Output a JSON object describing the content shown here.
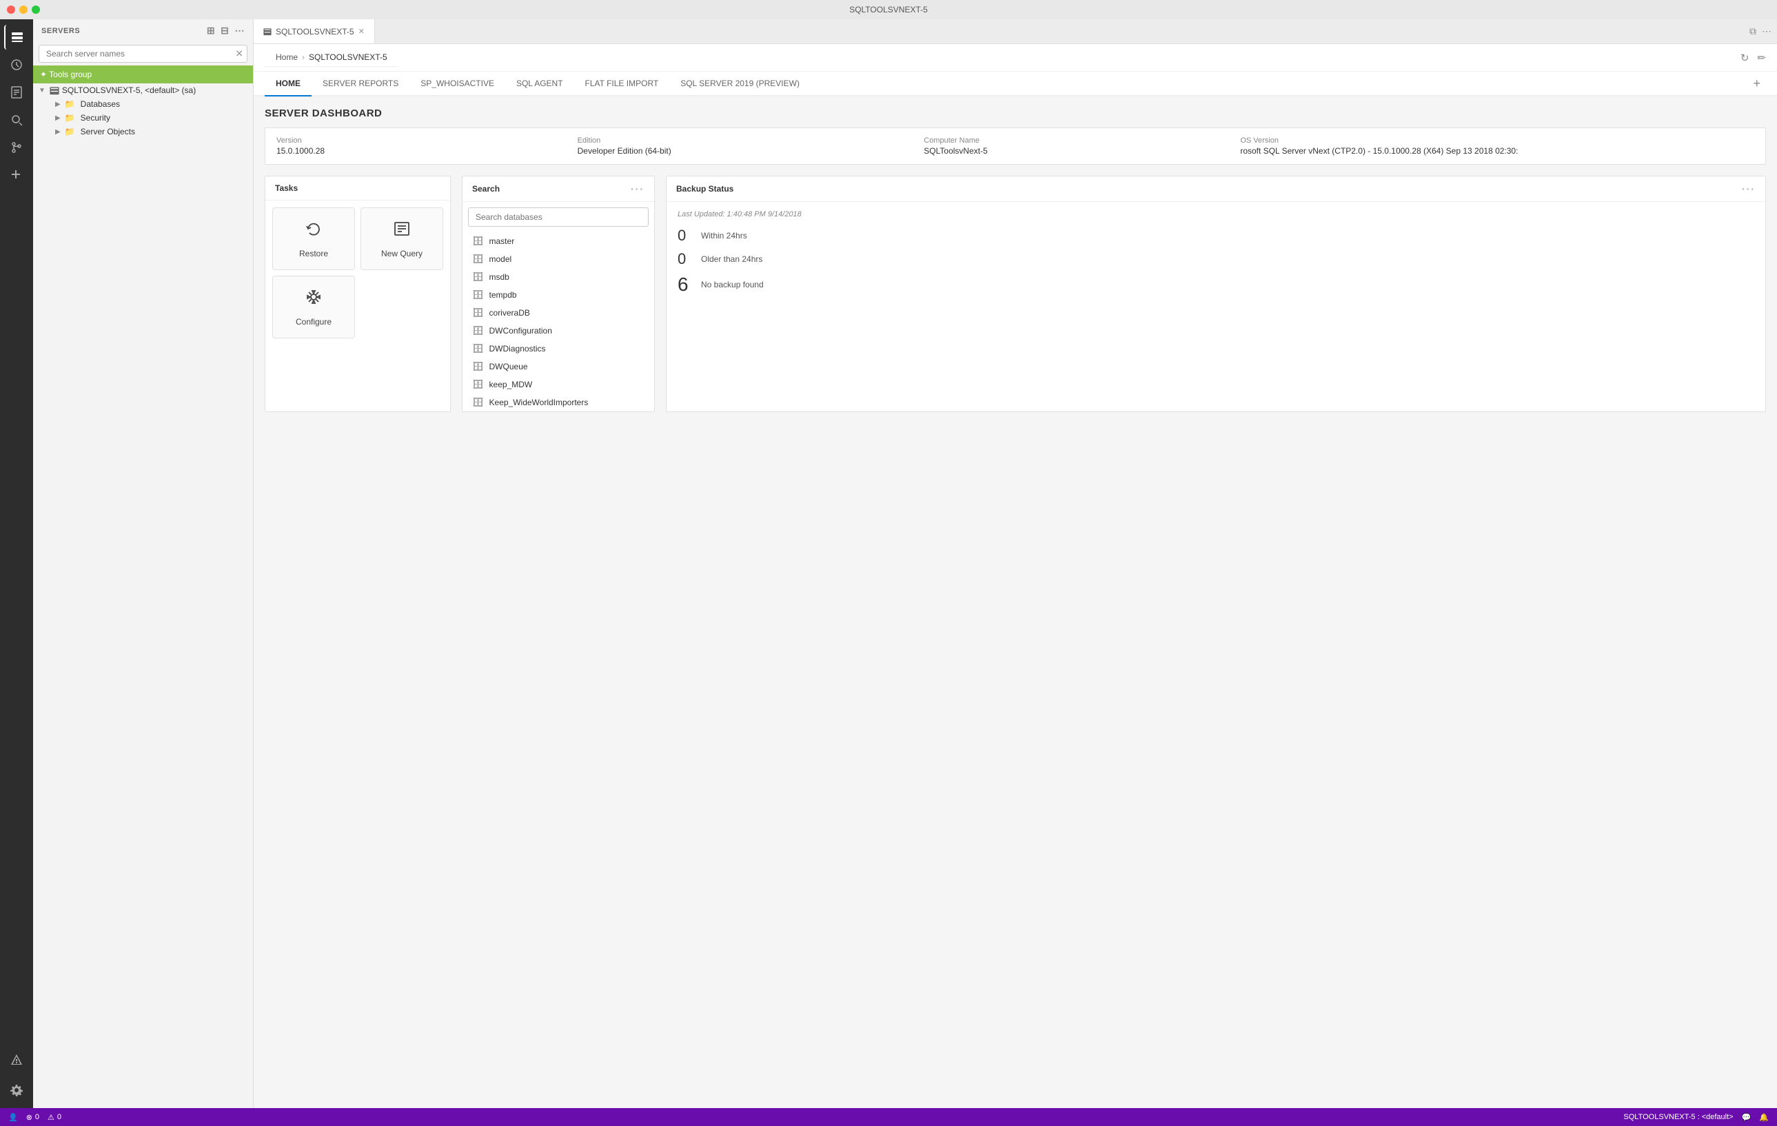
{
  "titleBar": {
    "title": "SQLTOOLSVNEXT-5"
  },
  "activityBar": {
    "icons": [
      {
        "name": "servers-icon",
        "symbol": "⊞",
        "active": true
      },
      {
        "name": "history-icon",
        "symbol": "🕐",
        "active": false
      },
      {
        "name": "documents-icon",
        "symbol": "📄",
        "active": false
      },
      {
        "name": "search-icon",
        "symbol": "🔍",
        "active": false
      },
      {
        "name": "git-icon",
        "symbol": "⑂",
        "active": false
      },
      {
        "name": "extensions-icon",
        "symbol": "⬡",
        "active": false
      },
      {
        "name": "alert-icon",
        "symbol": "⚠",
        "active": false
      }
    ],
    "bottomIcons": [
      {
        "name": "settings-icon",
        "symbol": "⚙"
      }
    ]
  },
  "sidebar": {
    "header": "SERVERS",
    "searchPlaceholder": "Search server names",
    "toolsGroup": "✦ Tools group",
    "serverTree": {
      "serverName": "SQLTOOLSVNEXT-5, <default> (sa)",
      "children": [
        {
          "label": "Databases",
          "icon": "📁"
        },
        {
          "label": "Security",
          "icon": "📁"
        },
        {
          "label": "Server Objects",
          "icon": "📁"
        }
      ]
    }
  },
  "tabs": {
    "openTab": "SQLTOOLSVNEXT-5",
    "closeIcon": "✕"
  },
  "breadcrumb": {
    "home": "Home",
    "sep": "›",
    "current": "SQLTOOLSVNEXT-5"
  },
  "contentTabs": [
    {
      "label": "HOME",
      "active": true
    },
    {
      "label": "SERVER REPORTS",
      "active": false
    },
    {
      "label": "SP_WHOISACTIVE",
      "active": false
    },
    {
      "label": "SQL AGENT",
      "active": false
    },
    {
      "label": "FLAT FILE IMPORT",
      "active": false
    },
    {
      "label": "SQL SERVER 2019 (PREVIEW)",
      "active": false
    }
  ],
  "dashboard": {
    "title": "SERVER DASHBOARD",
    "serverInfo": {
      "versionLabel": "Version",
      "versionValue": "15.0.1000.28",
      "editionLabel": "Edition",
      "editionValue": "Developer Edition (64-bit)",
      "computerNameLabel": "Computer Name",
      "computerNameValue": "SQLToolsvNext-5",
      "osVersionLabel": "OS Version",
      "osVersionValue": "rosoft SQL Server vNext (CTP2.0) - 15.0.1000.28 (X64) Sep 13 2018 02:30:"
    }
  },
  "tasksPanel": {
    "title": "Tasks",
    "buttons": [
      {
        "label": "Restore",
        "icon": "↩"
      },
      {
        "label": "New Query",
        "icon": "☰"
      },
      {
        "label": "Configure",
        "icon": "⚙"
      }
    ]
  },
  "searchPanel": {
    "title": "Search",
    "placeholder": "Search databases",
    "databases": [
      "master",
      "model",
      "msdb",
      "tempdb",
      "coriveraDB",
      "DWConfiguration",
      "DWDiagnostics",
      "DWQueue",
      "keep_MDW",
      "Keep_WideWorldImporters"
    ]
  },
  "backupPanel": {
    "title": "Backup Status",
    "menuDots": "···",
    "lastUpdated": "Last Updated: 1:40:48 PM 9/14/2018",
    "stats": [
      {
        "num": "0",
        "label": "Within 24hrs"
      },
      {
        "num": "0",
        "label": "Older than 24hrs"
      },
      {
        "num": "6",
        "label": "No backup found"
      }
    ]
  },
  "statusBar": {
    "leftItems": [
      {
        "name": "user-icon",
        "symbol": "👤"
      },
      {
        "name": "error-badge",
        "symbol": "⊗",
        "count": "0"
      },
      {
        "name": "warning-badge",
        "symbol": "⚠",
        "count": "0"
      }
    ],
    "connection": "SQLTOOLSVNEXT-5 : <default>",
    "rightIcons": [
      {
        "name": "chat-icon",
        "symbol": "💬"
      },
      {
        "name": "bell-icon",
        "symbol": "🔔"
      }
    ]
  }
}
